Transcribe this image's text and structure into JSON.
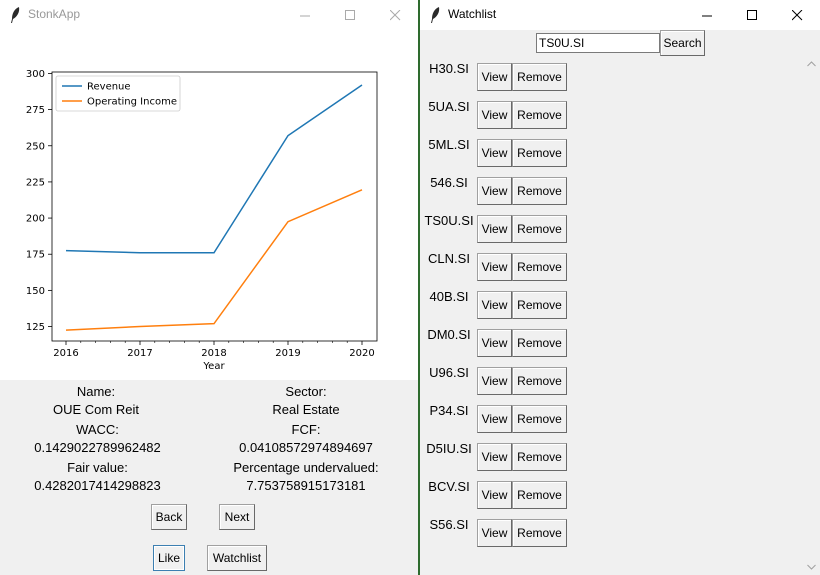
{
  "left_window": {
    "title": "StonkApp",
    "icons": {
      "app": "feather-icon",
      "minimize": "minimize-icon",
      "maximize": "maximize-icon",
      "close": "close-icon"
    }
  },
  "chart_data": {
    "type": "line",
    "x": [
      2016,
      2017,
      2018,
      2019,
      2020
    ],
    "series": [
      {
        "name": "Revenue",
        "values": [
          177.5,
          176.0,
          176.0,
          257.0,
          292.0
        ],
        "color": "#1f77b4"
      },
      {
        "name": "Operating Income",
        "values": [
          122.5,
          125.0,
          127.0,
          197.5,
          219.5
        ],
        "color": "#ff7f0e"
      }
    ],
    "xlabel": "Year",
    "ylabel": "",
    "xticks": [
      "2016",
      "2017",
      "2018",
      "2019",
      "2020"
    ],
    "yticks": [
      "125",
      "150",
      "175",
      "200",
      "225",
      "250",
      "275",
      "300"
    ],
    "xlim": [
      2016,
      2020
    ],
    "ylim": [
      115,
      301
    ],
    "grid": false,
    "legend_position": "top-left"
  },
  "stock_info": {
    "name_label": "Name:",
    "name_value": "OUE Com Reit",
    "sector_label": "Sector:",
    "sector_value": "Real Estate",
    "wacc_label": "WACC:",
    "wacc_value": "0.1429022789962482",
    "fcf_label": "FCF:",
    "fcf_value": "0.04108572974894697",
    "fair_value_label": "Fair value:",
    "fair_value_value": "0.4282017414298823",
    "undervalued_label": "Percentage undervalued:",
    "undervalued_value": "7.753758915173181"
  },
  "buttons": {
    "back": "Back",
    "next": "Next",
    "like": "Like",
    "watchlist": "Watchlist"
  },
  "right_window": {
    "title": "Watchlist",
    "search_value": "TS0U.SI",
    "search_button": "Search",
    "view_label": "View",
    "remove_label": "Remove",
    "items": [
      "H30.SI",
      "5UA.SI",
      "5ML.SI",
      "546.SI",
      "TS0U.SI",
      "CLN.SI",
      "40B.SI",
      "DM0.SI",
      "U96.SI",
      "P34.SI",
      "D5IU.SI",
      "BCV.SI",
      "S56.SI"
    ]
  }
}
